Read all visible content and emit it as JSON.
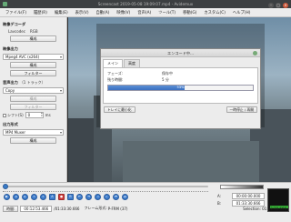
{
  "window": {
    "title": "Screencast 2019-05-08 19:09:07.mp4 - Avidemux"
  },
  "menu": [
    "ファイル(F)",
    "履歴(R)",
    "編集(E)",
    "表示(V)",
    "自動(A)",
    "映像(V)",
    "音声(A)",
    "ツール(T)",
    "移動(G)",
    "カスタム(C)",
    "ヘルプ(H)"
  ],
  "left": {
    "video_decoder": {
      "title": "映像デコーダ",
      "lavcodec": "Lavcodec",
      "rgb": "RGB",
      "config": "構成"
    },
    "video_output": {
      "title": "映像出力",
      "codec": "Mpeg4 AVC (x264)",
      "config": "構成",
      "filters": "フィルター"
    },
    "audio_output": {
      "title": "音声出力",
      "tracks": "（1 トラック）",
      "codec": "Copy",
      "config": "構成",
      "filters": "フィルター",
      "shift_label": "シフト(S)",
      "shift_value": "0",
      "shift_unit": "ms"
    },
    "output_format": {
      "title": "出力形式",
      "container": "MP4 Muxer",
      "config": "構成"
    }
  },
  "dialog": {
    "title": "エンコード中...",
    "tabs": [
      "メイン",
      "高度"
    ],
    "phase_label": "フェーズ:",
    "phase_value": "保存中",
    "remaining_label": "残り時間:",
    "remaining_value": "5 分",
    "progress_percent": 53,
    "progress_text": "53%",
    "tray_button": "トレイに最小化",
    "pause_button": "一時停止 / 再開"
  },
  "bottom": {
    "a_label": "A:",
    "b_label": "B:",
    "a_time": "00:00:00.000",
    "b_time": "01:33:30.666",
    "time_button": "時間:",
    "current_time": "00:12:53.466",
    "total_time": "/01:33:30.666",
    "frame_type": "フレーム形式:",
    "frame_value": "P-FRM (37)",
    "selection": "Selection: 01:33:30.666"
  },
  "colors": {
    "accent": "#3d7ccc",
    "progress": "#3a6fc0",
    "record": "#d03b3b"
  }
}
